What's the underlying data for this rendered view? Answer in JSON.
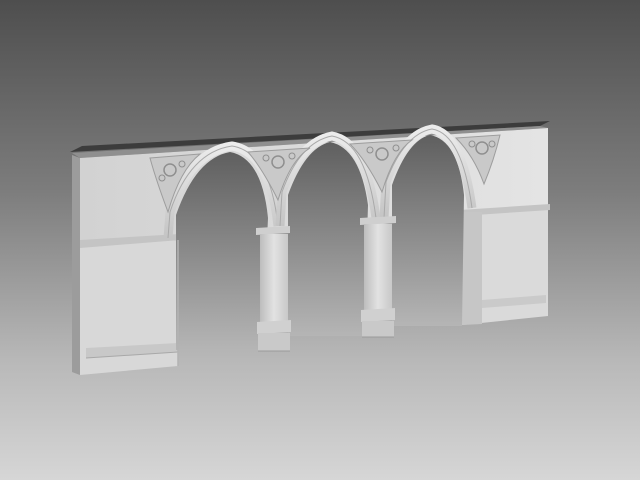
{
  "scene": {
    "subject": "gothic-arcade-wall-3d-model",
    "arch_count": 3,
    "pillar_count": 2,
    "colors": {
      "background_top": "#4e4e4e",
      "background_bottom": "#d6d6d6",
      "wall_face": "#d9d9d9",
      "wall_side": "#9a9a9a",
      "wall_top": "#3a3a3a",
      "shadow": "#8c8c8c"
    }
  }
}
